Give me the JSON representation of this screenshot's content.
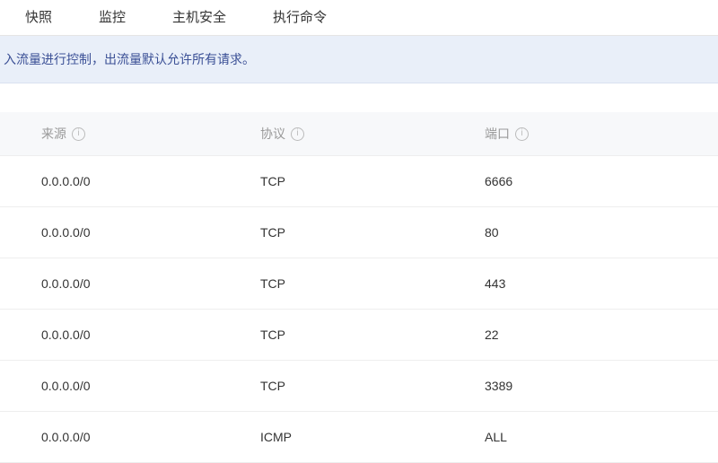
{
  "tabs": {
    "snapshot": "快照",
    "monitor": "监控",
    "host_security": "主机安全",
    "exec_cmd": "执行命令"
  },
  "notice": "入流量进行控制，出流量默认允许所有请求。",
  "table": {
    "headers": {
      "source": "来源",
      "protocol": "协议",
      "port": "端口"
    },
    "rows": [
      {
        "source": "0.0.0.0/0",
        "protocol": "TCP",
        "port": "6666"
      },
      {
        "source": "0.0.0.0/0",
        "protocol": "TCP",
        "port": "80"
      },
      {
        "source": "0.0.0.0/0",
        "protocol": "TCP",
        "port": "443"
      },
      {
        "source": "0.0.0.0/0",
        "protocol": "TCP",
        "port": "22"
      },
      {
        "source": "0.0.0.0/0",
        "protocol": "TCP",
        "port": "3389"
      },
      {
        "source": "0.0.0.0/0",
        "protocol": "ICMP",
        "port": "ALL"
      }
    ]
  },
  "icons": {
    "info_glyph": "i"
  }
}
